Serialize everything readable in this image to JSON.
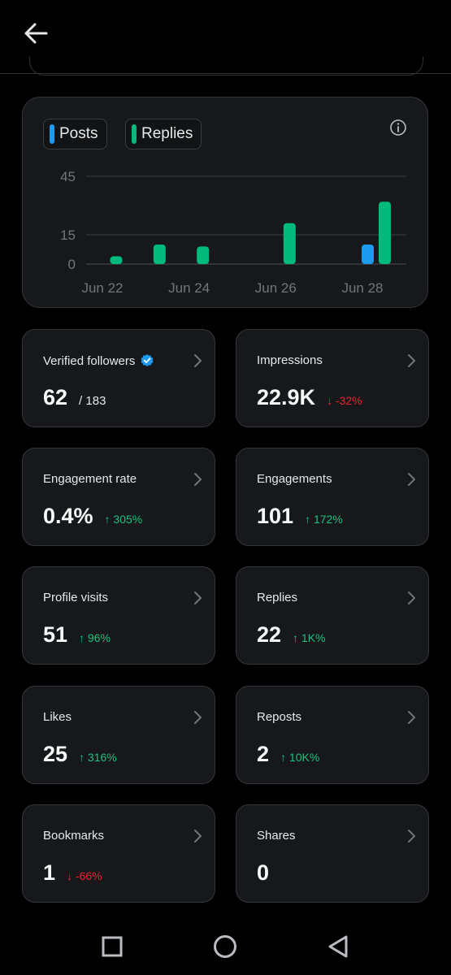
{
  "header": {
    "back_icon": "arrow-left-icon"
  },
  "legend": {
    "posts": "Posts",
    "replies": "Replies",
    "info_icon": "info-icon"
  },
  "colors": {
    "posts": "#1d9bf0",
    "replies": "#00ba7c",
    "up": "#19c37d",
    "down": "#f4212e",
    "verified": "#1d9bf0"
  },
  "chart_data": {
    "type": "bar",
    "categories": [
      "Jun 22",
      "Jun 23",
      "Jun 24",
      "Jun 25",
      "Jun 26",
      "Jun 27",
      "Jun 28"
    ],
    "x_tick_labels": [
      "Jun 22",
      "Jun 24",
      "Jun 26",
      "Jun 28"
    ],
    "y_ticks": [
      "45",
      "15",
      "0"
    ],
    "ylim": [
      0,
      45
    ],
    "series": [
      {
        "name": "Posts",
        "values": [
          0,
          0,
          0,
          0,
          0,
          0,
          10
        ]
      },
      {
        "name": "Replies",
        "values": [
          4,
          10,
          9,
          0,
          21,
          0,
          32
        ]
      }
    ],
    "grid": true
  },
  "stats": [
    {
      "title": "Verified followers",
      "value": "62",
      "sub": "/ 183",
      "delta": "",
      "dir": "",
      "verified": true
    },
    {
      "title": "Impressions",
      "value": "22.9K",
      "sub": "",
      "delta": "↓ -32%",
      "dir": "down"
    },
    {
      "title": "Engagement rate",
      "value": "0.4%",
      "sub": "",
      "delta": "↑ 305%",
      "dir": "up"
    },
    {
      "title": "Engagements",
      "value": "101",
      "sub": "",
      "delta": "↑ 172%",
      "dir": "up"
    },
    {
      "title": "Profile visits",
      "value": "51",
      "sub": "",
      "delta": "↑ 96%",
      "dir": "up"
    },
    {
      "title": "Replies",
      "value": "22",
      "sub": "",
      "delta": "↑ 1K%",
      "dir": "up"
    },
    {
      "title": "Likes",
      "value": "25",
      "sub": "",
      "delta": "↑ 316%",
      "dir": "up"
    },
    {
      "title": "Reposts",
      "value": "2",
      "sub": "",
      "delta": "↑ 10K%",
      "dir": "up"
    },
    {
      "title": "Bookmarks",
      "value": "1",
      "sub": "",
      "delta": "↓ -66%",
      "dir": "down"
    },
    {
      "title": "Shares",
      "value": "0",
      "sub": "",
      "delta": "",
      "dir": ""
    }
  ],
  "navbar": {
    "recents": "square-icon",
    "home": "circle-icon",
    "back": "triangle-back-icon"
  }
}
